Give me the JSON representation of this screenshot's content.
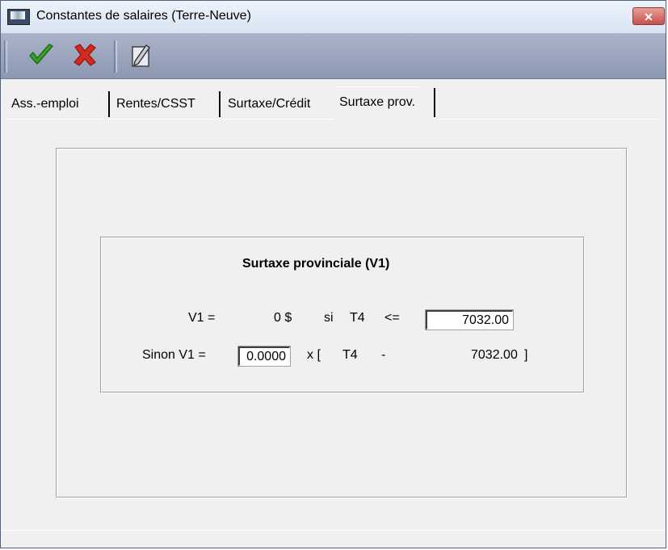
{
  "window": {
    "title": "Constantes de salaires (Terre-Neuve)",
    "close_label": "✕"
  },
  "toolbar": {
    "buttons": [
      {
        "name": "confirm",
        "icon": "checkmark-icon"
      },
      {
        "name": "cancel",
        "icon": "red-x-icon"
      },
      {
        "name": "edit",
        "icon": "pencil-icon"
      }
    ]
  },
  "tabs": [
    {
      "label": "Ass.-emploi",
      "active": false
    },
    {
      "label": "Rentes/CSST",
      "active": false
    },
    {
      "label": "Surtaxe/Crédit",
      "active": false
    },
    {
      "label": "Surtaxe prov.",
      "active": true
    }
  ],
  "surtaxe": {
    "heading": "Surtaxe provinciale  (V1)",
    "row1": {
      "lhs": "V1  =",
      "amount": "0 $",
      "si": "si",
      "t4": "T4",
      "op": "<=",
      "threshold_value": "7032.00"
    },
    "row2": {
      "lhs": "Sinon V1  =",
      "rate_value": "0.0000",
      "mult": "x  [",
      "t4": "T4",
      "minus": "-",
      "threshold": "7032.00",
      "close": "]"
    }
  },
  "colors": {
    "toolbar_bg": "#9aa4bc",
    "check_green": "#3aa02a",
    "x_red": "#d42a1e",
    "close_red": "#c75050"
  }
}
